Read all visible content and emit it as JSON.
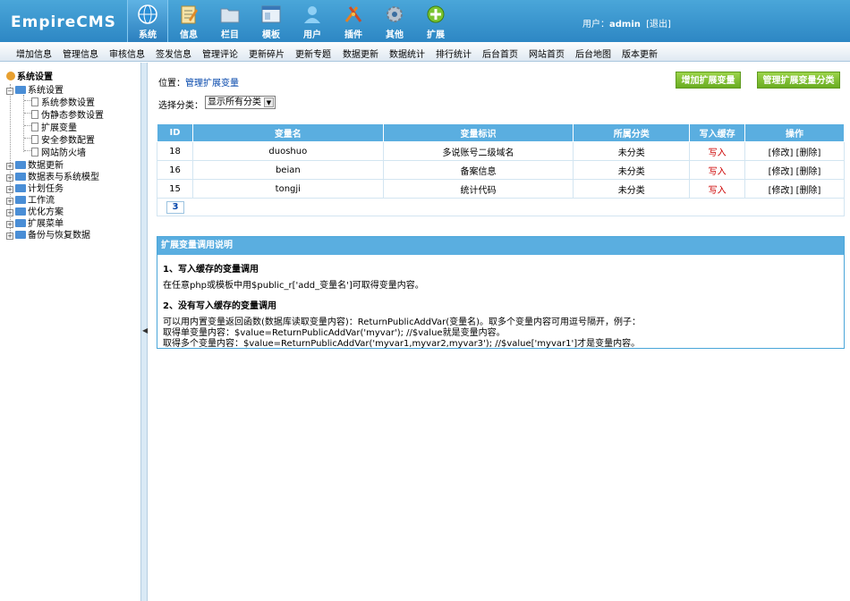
{
  "header": {
    "logo_text": "EmpireCMS",
    "nav": [
      {
        "label": "系统",
        "icon": "globe-icon"
      },
      {
        "label": "信息",
        "icon": "notepad-icon"
      },
      {
        "label": "栏目",
        "icon": "folder-icon"
      },
      {
        "label": "模板",
        "icon": "window-icon"
      },
      {
        "label": "用户",
        "icon": "user-icon"
      },
      {
        "label": "插件",
        "icon": "tools-icon"
      },
      {
        "label": "其他",
        "icon": "gear-icon"
      },
      {
        "label": "扩展",
        "icon": "plus-icon"
      }
    ],
    "user_label": "用户：",
    "username": "admin",
    "logout": "[退出]"
  },
  "menubar": [
    "增加信息",
    "管理信息",
    "审核信息",
    "签发信息",
    "管理评论",
    "更新碎片",
    "更新专题",
    "数据更新",
    "数据统计",
    "排行统计",
    "后台首页",
    "网站首页",
    "后台地图",
    "版本更新"
  ],
  "sidebar": {
    "root": "系统设置",
    "open_folder": "系统设置",
    "children": [
      "系统参数设置",
      "伪静态参数设置",
      "扩展变量",
      "安全参数配置",
      "网站防火墙"
    ],
    "folders": [
      "数据更新",
      "数据表与系统模型",
      "计划任务",
      "工作流",
      "优化方案",
      "扩展菜单",
      "备份与恢复数据"
    ]
  },
  "main": {
    "crumb_label": "位置：",
    "crumb_link": "管理扩展变量",
    "btn_add": "增加扩展变量",
    "btn_manage": "管理扩展变量分类",
    "select_label": "选择分类：",
    "select_value": "显示所有分类",
    "table": {
      "headers": [
        "ID",
        "变量名",
        "变量标识",
        "所属分类",
        "写入缓存",
        "操作"
      ],
      "rows": [
        {
          "id": "18",
          "name": "duoshuo",
          "label": "多说账号二级域名",
          "cat": "未分类",
          "cache": "写入",
          "edit": "[修改]",
          "del": "[删除]"
        },
        {
          "id": "16",
          "name": "beian",
          "label": "备案信息",
          "cat": "未分类",
          "cache": "写入",
          "edit": "[修改]",
          "del": "[删除]"
        },
        {
          "id": "15",
          "name": "tongji",
          "label": "统计代码",
          "cat": "未分类",
          "cache": "写入",
          "edit": "[修改]",
          "del": "[删除]"
        }
      ],
      "pager": "3"
    },
    "help": {
      "title": "扩展变量调用说明",
      "s1_title": "1、写入缓存的变量调用",
      "s1_text": "在任意php或模板中用$public_r['add_变量名']可取得变量内容。",
      "s2_title": "2、没有写入缓存的变量调用",
      "s2_l1": "可以用内置变量返回函数(数据库读取变量内容)：ReturnPublicAddVar(变量名)。取多个变量内容可用逗号隔开，例子：",
      "s2_l2": "取得单变量内容：$value=ReturnPublicAddVar('myvar'); //$value就是变量内容。",
      "s2_l3": "取得多个变量内容：$value=ReturnPublicAddVar('myvar1,myvar2,myvar3'); //$value['myvar1']才是变量内容。"
    }
  }
}
